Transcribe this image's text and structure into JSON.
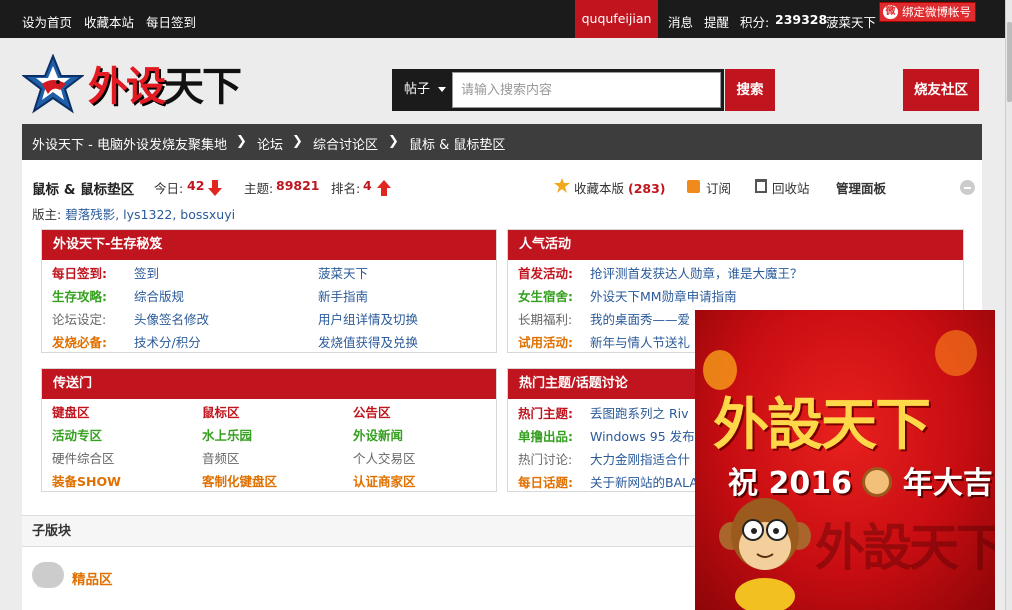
{
  "topbar": {
    "set_home": "设为首页",
    "bookmark_site": "收藏本站",
    "daily_signin": "每日签到",
    "username": "ququfeijian",
    "messages": "消息",
    "reminders": "提醒",
    "points_label": "积分:",
    "points_value": "239328",
    "level": "菠菜天下",
    "bind_weibo": "绑定微博帐号"
  },
  "logo": {
    "text_red": "外设",
    "text_black": "天下"
  },
  "search": {
    "type": "帖子",
    "placeholder": "请输入搜索内容",
    "button": "搜索"
  },
  "community_button": "烧友社区",
  "breadcrumb": [
    "外设天下 - 电脑外设发烧友聚集地",
    "论坛",
    "综合讨论区",
    "鼠标 & 鼠标垫区"
  ],
  "forum": {
    "title": "鼠标 & 鼠标垫区",
    "today_label": "今日:",
    "today_value": "42",
    "topics_label": "主题:",
    "topics_value": "89821",
    "rank_label": "排名:",
    "rank_value": "4",
    "moderators_label": "版主:",
    "moderators": "碧落残影, lys1322, bossxuyi",
    "favorite_label": "收藏本版",
    "favorite_count": "(283)",
    "subscribe": "订阅",
    "recycle": "回收站",
    "admin_panel": "管理面板"
  },
  "panel_survival": {
    "title": "外设天下-生存秘笈",
    "rows": [
      {
        "label": "每日签到:",
        "link1": "签到",
        "link2": "菠菜天下"
      },
      {
        "label": "生存攻略:",
        "link1": "综合版规",
        "link2": "新手指南"
      },
      {
        "label": "论坛设定:",
        "link1": "头像签名修改",
        "link2": "用户组详情及切换"
      },
      {
        "label": "发烧必备:",
        "link1": "技术分/积分",
        "link2": "发烧值获得及兑换"
      }
    ]
  },
  "panel_activity": {
    "title": "人气活动",
    "rows": [
      {
        "label": "首发活动:",
        "text": "抢评测首发获达人勋章，谁是大魔王？"
      },
      {
        "label": "女生宿舍:",
        "text": "外设天下MM勋章申请指南"
      },
      {
        "label": "长期福利:",
        "text": "我的桌面秀——爱"
      },
      {
        "label": "试用活动:",
        "text": "新年与情人节送礼"
      }
    ]
  },
  "panel_portal": {
    "title": "传送门",
    "rows": [
      [
        "键盘区",
        "鼠标区",
        "公告区"
      ],
      [
        "活动专区",
        "水上乐园",
        "外设新闻"
      ],
      [
        "硬件综合区",
        "音频区",
        "个人交易区"
      ],
      [
        "装备SHOW",
        "客制化键盘区",
        "认证商家区"
      ]
    ]
  },
  "panel_hot": {
    "title": "热门主题/话题讨论",
    "rows": [
      {
        "label": "热门主题:",
        "text": "丢图跑系列之 Riv"
      },
      {
        "label": "单撸出品:",
        "text": "Windows 95 发布"
      },
      {
        "label": "热门讨论:",
        "text": "大力金刚指适合什"
      },
      {
        "label": "每日话题:",
        "text": "关于新网站的BALA"
      }
    ]
  },
  "subforums": {
    "title": "子版块",
    "items": [
      "精品区"
    ]
  },
  "popup_ad": {
    "title": "外設天下",
    "greeting_pre": "祝",
    "year": "2016",
    "greeting_post": "年大吉",
    "watermark": "外設天下"
  },
  "colors": {
    "brand_red": "#c0151f",
    "topbar_bg": "#1b1b1b",
    "crumb_bg": "#3d3d3d"
  }
}
